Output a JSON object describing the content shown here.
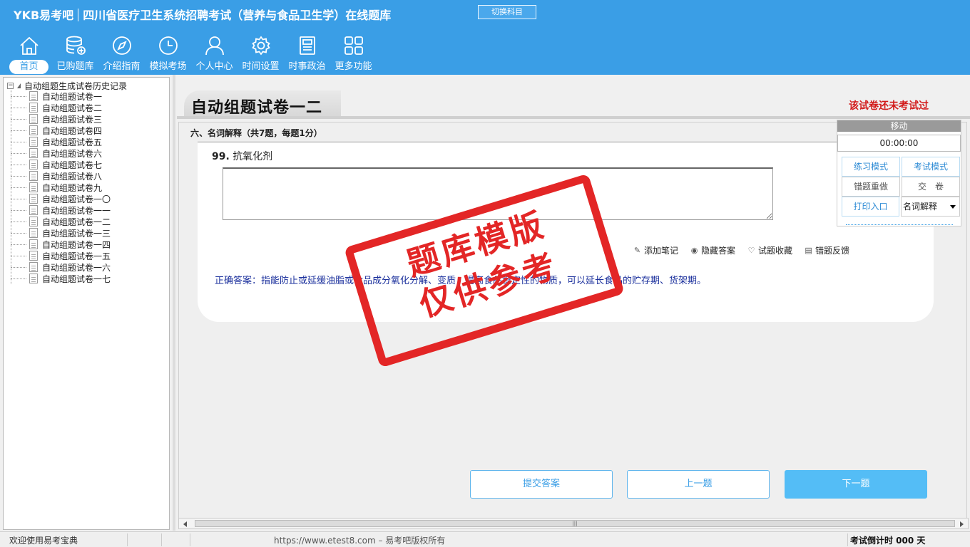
{
  "app": {
    "logo": "YKB易考吧",
    "title": "四川省医疗卫生系统招聘考试（营养与食品卫生学）在线题库",
    "switch_label": "切换科目"
  },
  "nav": [
    {
      "label": "首页",
      "icon": "home-icon"
    },
    {
      "label": "已购题库",
      "icon": "database-icon"
    },
    {
      "label": "介绍指南",
      "icon": "compass-icon"
    },
    {
      "label": "模拟考场",
      "icon": "clock-icon"
    },
    {
      "label": "个人中心",
      "icon": "user-icon"
    },
    {
      "label": "时间设置",
      "icon": "gear-icon"
    },
    {
      "label": "时事政治",
      "icon": "news-icon"
    },
    {
      "label": "更多功能",
      "icon": "grid-icon"
    }
  ],
  "tree": {
    "root": "自动组题生成试卷历史记录",
    "items": [
      "自动组题试卷一",
      "自动组题试卷二",
      "自动组题试卷三",
      "自动组题试卷四",
      "自动组题试卷五",
      "自动组题试卷六",
      "自动组题试卷七",
      "自动组题试卷八",
      "自动组题试卷九",
      "自动组题试卷一〇",
      "自动组题试卷一一",
      "自动组题试卷一二",
      "自动组题试卷一三",
      "自动组题试卷一四",
      "自动组题试卷一五",
      "自动组题试卷一六",
      "自动组题试卷一七"
    ]
  },
  "main": {
    "page_title": "自动组题试卷一二",
    "status": "该试卷还未考试过",
    "section": "六、名词解释（共7题，每题1分）",
    "question": {
      "number": "99.",
      "text": "抗氧化剂"
    },
    "tools": [
      "添加笔记",
      "隐藏答案",
      "试题收藏",
      "错题反馈"
    ],
    "correct_answer": "正确答案：指能防止或延缓油脂或食品成分氧化分解、变质，提高食品稳定性的物质，可以延长食品的贮存期、货架期。",
    "buttons": {
      "submit": "提交答案",
      "prev": "上一题",
      "next": "下一题"
    }
  },
  "float_panel": {
    "header": "移动",
    "timer": "00:00:00",
    "practice_mode": "练习模式",
    "exam_mode": "考试模式",
    "redo_wrong": "错题重做",
    "hand_in": "交　卷",
    "print": "打印入口",
    "type_select": "名词解释"
  },
  "statusbar": {
    "welcome": "欢迎使用易考宝典",
    "copyright": "https://www.etest8.com – 易考吧版权所有",
    "countdown": "考试倒计时 000 天"
  },
  "stamp": {
    "line1": "题库模版",
    "line2": "仅供参考"
  },
  "colors": {
    "header": "#3a9ee6",
    "status_red": "#d21a1a",
    "answer_blue": "#1a2f9c",
    "stamp_red": "#e32626"
  }
}
